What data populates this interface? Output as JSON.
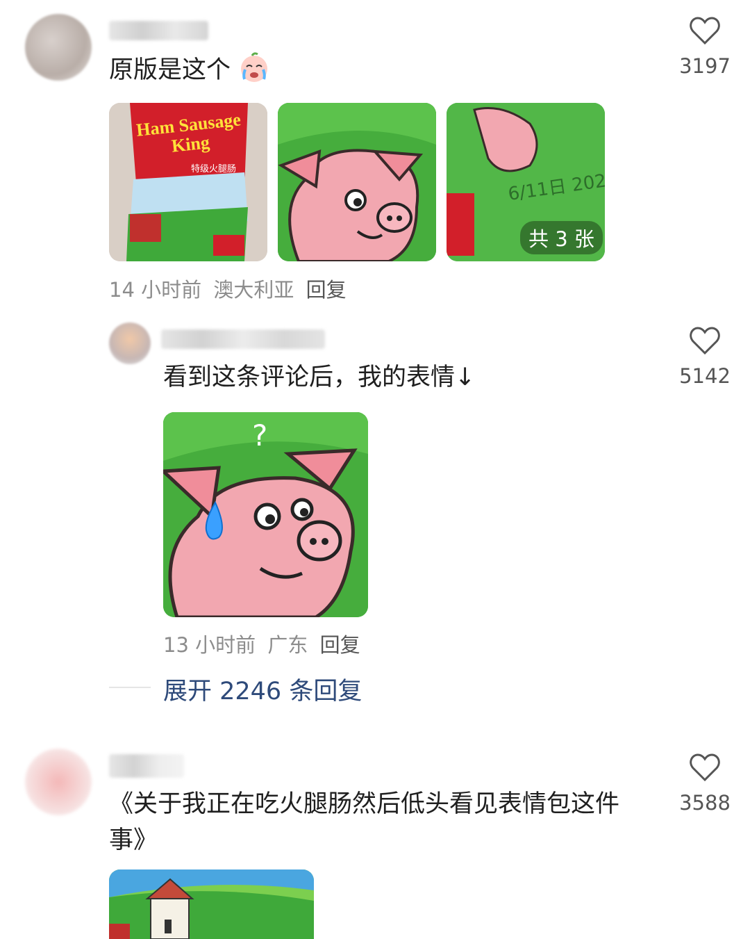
{
  "comments": [
    {
      "text": "原版是这个",
      "emoji": "crying-face-icon",
      "likes": "3197",
      "meta": {
        "time": "14 小时前",
        "location": "澳大利亚",
        "reply": "回复"
      },
      "images": [
        {
          "label": "Ham Sausage King",
          "sublabel": "特级火腿肠"
        },
        {
          "label": ""
        },
        {
          "label": "",
          "overlay": "共 3 张"
        }
      ]
    },
    {
      "text": "看到这条评论后，我的表情↓",
      "likes": "5142",
      "meta": {
        "time": "13 小时前",
        "location": "广东",
        "reply": "回复"
      },
      "expand": "展开 2246 条回复"
    },
    {
      "text_line1": "《关于我正在吃火腿肠然后低头看见表情包这件",
      "text_line2": "事》",
      "likes": "3588"
    }
  ],
  "colors": {
    "accent_link": "#2e4a7a",
    "meta_gray": "#8c8c8c",
    "pig_pink": "#f2a7b0",
    "grass_green": "#3fa93a"
  }
}
